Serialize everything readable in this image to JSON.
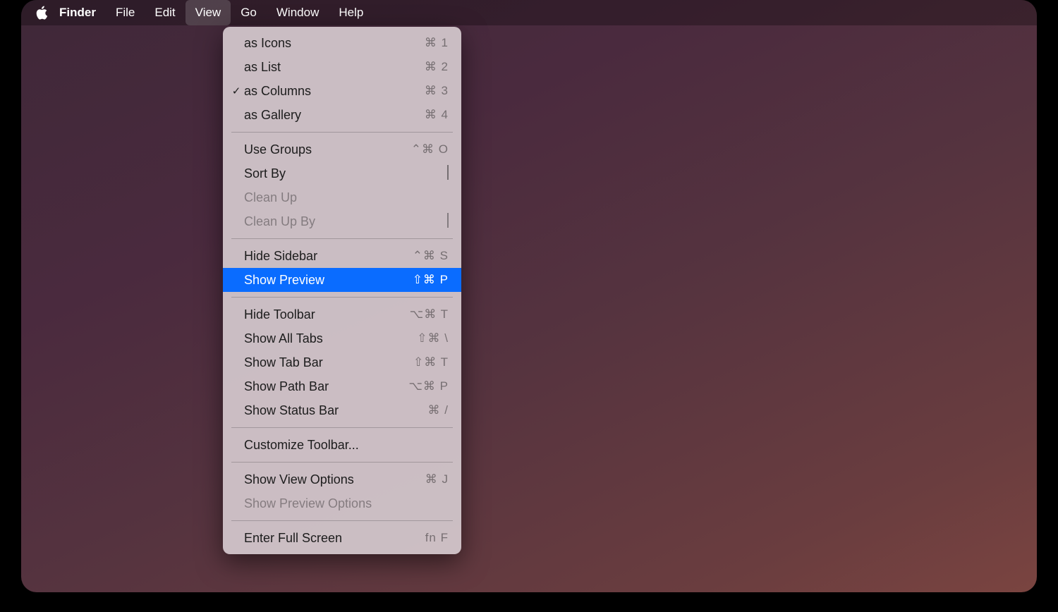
{
  "menubar": {
    "app": "Finder",
    "items": [
      "File",
      "Edit",
      "View",
      "Go",
      "Window",
      "Help"
    ],
    "active": "View"
  },
  "dropdown": {
    "groups": [
      [
        {
          "label": "as Icons",
          "shortcut": "⌘ 1",
          "checked": false
        },
        {
          "label": "as List",
          "shortcut": "⌘ 2",
          "checked": false
        },
        {
          "label": "as Columns",
          "shortcut": "⌘ 3",
          "checked": true
        },
        {
          "label": "as Gallery",
          "shortcut": "⌘ 4",
          "checked": false
        }
      ],
      [
        {
          "label": "Use Groups",
          "shortcut": "⌃⌘ O"
        },
        {
          "label": "Sort By",
          "submenu": true
        },
        {
          "label": "Clean Up",
          "disabled": true
        },
        {
          "label": "Clean Up By",
          "submenu": true,
          "disabled": true
        }
      ],
      [
        {
          "label": "Hide Sidebar",
          "shortcut": "⌃⌘ S"
        },
        {
          "label": "Show Preview",
          "shortcut": "⇧⌘ P",
          "selected": true
        }
      ],
      [
        {
          "label": "Hide Toolbar",
          "shortcut": "⌥⌘ T"
        },
        {
          "label": "Show All Tabs",
          "shortcut": "⇧⌘ \\"
        },
        {
          "label": "Show Tab Bar",
          "shortcut": "⇧⌘ T"
        },
        {
          "label": "Show Path Bar",
          "shortcut": "⌥⌘ P"
        },
        {
          "label": "Show Status Bar",
          "shortcut": "⌘ /"
        }
      ],
      [
        {
          "label": "Customize Toolbar..."
        }
      ],
      [
        {
          "label": "Show View Options",
          "shortcut": "⌘ J"
        },
        {
          "label": "Show Preview Options",
          "disabled": true
        }
      ],
      [
        {
          "label": "Enter Full Screen",
          "shortcut": "fn F"
        }
      ]
    ]
  }
}
